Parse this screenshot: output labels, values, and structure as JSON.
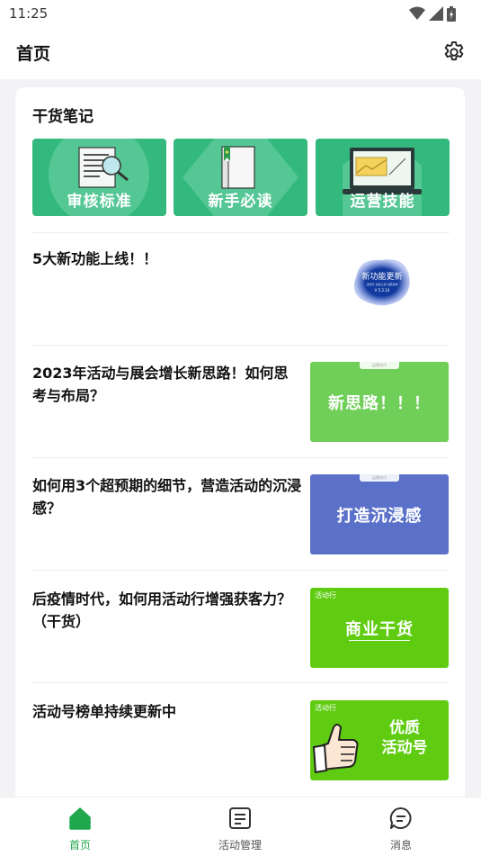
{
  "status_bar": {
    "time": "11:25"
  },
  "header": {
    "title": "首页"
  },
  "section": {
    "title": "干货笔记"
  },
  "guides": [
    {
      "label": "审核标准"
    },
    {
      "label": "新手必读"
    },
    {
      "label": "运营技能"
    }
  ],
  "articles": [
    {
      "title": "5大新功能上线！！",
      "thumb_title": "新功能更新",
      "thumb_sub": "活动行 全新上线 功能说明",
      "thumb_version": "V 5.2.10"
    },
    {
      "title": "2023年活动与展会增长新思路！如何思考与布局？",
      "thumb_text": "新思路！！！",
      "thumb_tag": "运营技巧",
      "thumb_color": "#6fcf58"
    },
    {
      "title": "如何用3个超预期的细节，营造活动的沉浸感？",
      "thumb_text": "打造沉浸感",
      "thumb_tag": "运营技巧",
      "thumb_color": "#5b71c9"
    },
    {
      "title": "后疫情时代，如何用活动行增强获客力？（干货）",
      "thumb_text": "商业干货",
      "thumb_brand": "活动行",
      "thumb_color": "#5fcc12"
    },
    {
      "title": "活动号榜单持续更新中",
      "thumb_text_line1": "优质",
      "thumb_text_line2": "活动号",
      "thumb_brand": "活动行",
      "thumb_color": "#5fcc12"
    }
  ],
  "bottom_nav": [
    {
      "label": "首页",
      "icon": "home-icon",
      "active": true
    },
    {
      "label": "活动管理",
      "icon": "list-icon",
      "active": false
    },
    {
      "label": "消息",
      "icon": "message-icon",
      "active": false
    }
  ],
  "colors": {
    "accent": "#1fa84e",
    "tile_green": "#33b87d"
  }
}
